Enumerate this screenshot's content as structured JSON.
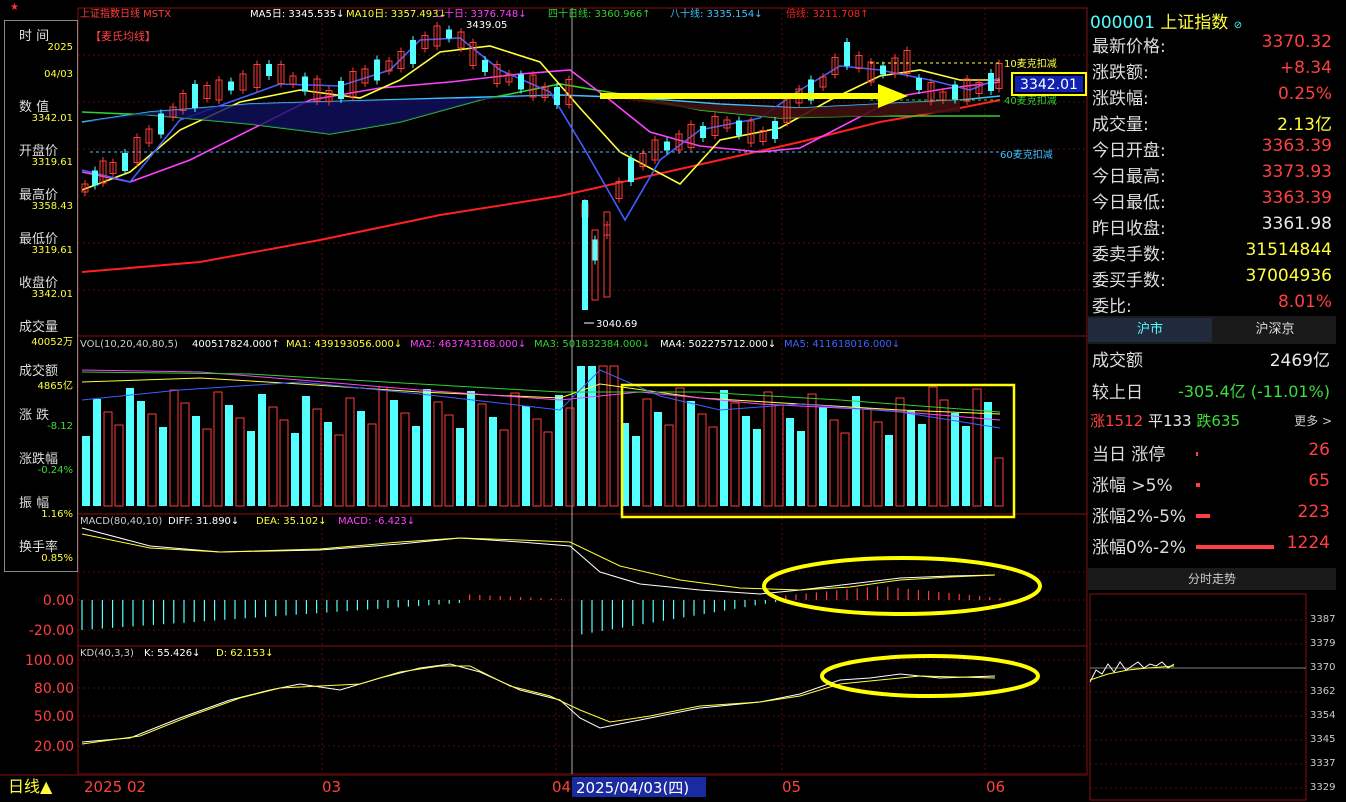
{
  "colors": {
    "up": "#ff3c3c",
    "down": "#54ffff",
    "ma5": "#ffffff",
    "ma10": "#ffff3a",
    "ma20": "#ff40ff",
    "ma40": "#30d030",
    "ma60": "#40c0ff",
    "ma_long": "#ff2020",
    "highlight": "#ffff00"
  },
  "header": {
    "legend_prefix": "上证指数日线 MSTX",
    "ma5": "MA5日: 3345.535↓",
    "ma10": "MA10日: 3357.493↓",
    "ma20": "二十日: 3376.748↓",
    "ma40": "四十日线: 3360.966↑",
    "ma80": "八十线: 3335.154↓",
    "ma_ratio": "倍线: 3211.708↑",
    "subtitle": "【麦氏均线】",
    "high_label": "3439.05",
    "low_label": "3040.69",
    "deduct10": "10麦克扣减",
    "deduct40": "40麦克扣减",
    "deduct60": "60麦克扣减",
    "price_tag": "3342.01"
  },
  "data_window": {
    "items": [
      {
        "label": "时 间",
        "value": ""
      },
      {
        "label": "",
        "value": "2025"
      },
      {
        "label": "",
        "value": "04/03"
      },
      {
        "label": "数 值",
        "value": ""
      },
      {
        "label": "",
        "value": "3342.01"
      },
      {
        "label": "开盘价",
        "value": ""
      },
      {
        "label": "",
        "value": "3319.61"
      },
      {
        "label": "最高价",
        "value": ""
      },
      {
        "label": "",
        "value": "3358.43"
      },
      {
        "label": "最低价",
        "value": ""
      },
      {
        "label": "",
        "value": "3319.61"
      },
      {
        "label": "收盘价",
        "value": ""
      },
      {
        "label": "",
        "value": "3342.01"
      },
      {
        "label": "成交量",
        "value": ""
      },
      {
        "label": "",
        "value": "40052万"
      },
      {
        "label": "成交额",
        "value": ""
      },
      {
        "label": "",
        "value": "4865亿"
      },
      {
        "label": "涨 跌",
        "value": ""
      },
      {
        "label": "",
        "value": "-8.12"
      },
      {
        "label": "涨跌幅",
        "value": ""
      },
      {
        "label": "",
        "value": "-0.24%"
      },
      {
        "label": "振 幅",
        "value": ""
      },
      {
        "label": "",
        "value": "1.16%"
      },
      {
        "label": "换手率",
        "value": ""
      },
      {
        "label": "",
        "value": "0.85%"
      }
    ]
  },
  "volume": {
    "title": "VOL(10,20,40,80,5)",
    "v": "400517824.000↑",
    "ma1": "MA1: 439193056.000↓",
    "ma2": "MA2: 463743168.000↓",
    "ma3": "MA3: 501832384.000↓",
    "ma4": "MA4: 502275712.000↓",
    "ma5": "MA5: 411618016.000↓"
  },
  "macd": {
    "title": "MACD(80,40,10)",
    "diff": "DIFF: 31.890↓",
    "dea": "DEA: 35.102↓",
    "macd": "MACD: -6.423↓",
    "ticks": [
      "0.00",
      "-20.00"
    ]
  },
  "kd": {
    "title": "KD(40,3,3)",
    "k": "K: 55.426↓",
    "d": "D: 62.153↓",
    "ticks": [
      "100.00",
      "80.00",
      "50.00",
      "20.00"
    ]
  },
  "xaxis": {
    "period": "日线▲",
    "labels": [
      "2025 02",
      "03",
      "04",
      "05",
      "06"
    ],
    "cursor_date": "2025/04/03(四)"
  },
  "panel": {
    "code": "000001",
    "name": "上证指数",
    "rows": [
      {
        "label": "最新价格:",
        "value": "3370.32",
        "color": "red"
      },
      {
        "label": "涨跌额:",
        "value": "+8.34",
        "color": "red"
      },
      {
        "label": "涨跌幅:",
        "value": "0.25%",
        "color": "red"
      },
      {
        "label": "成交量:",
        "value": "2.13亿",
        "color": "yellow"
      },
      {
        "label": "今日开盘:",
        "value": "3363.39",
        "color": "red"
      },
      {
        "label": "今日最高:",
        "value": "3373.93",
        "color": "red"
      },
      {
        "label": "今日最低:",
        "value": "3363.39",
        "color": "red"
      },
      {
        "label": "昨日收盘:",
        "value": "3361.98",
        "color": "white"
      },
      {
        "label": "委卖手数:",
        "value": "31514844",
        "color": "yellow"
      },
      {
        "label": "委买手数:",
        "value": "37004936",
        "color": "yellow"
      },
      {
        "label": "委比:",
        "value": "8.01%",
        "color": "red"
      }
    ],
    "tabs": [
      "沪市",
      "沪深京"
    ],
    "turnover_label": "成交额",
    "turnover_value": "2469亿",
    "compare_label": "较上日",
    "compare_value": "-305.4亿 (-11.01%)",
    "breadth": {
      "up": "涨1512",
      "flat": "平133",
      "down": "跌635",
      "more": "更多 >"
    },
    "limits": [
      {
        "label": "当日 涨停",
        "value": "26",
        "bar": 0.02
      },
      {
        "label": "涨幅 >5%",
        "value": "65",
        "bar": 0.05
      },
      {
        "label": "涨幅2%-5%",
        "value": "223",
        "bar": 0.18
      },
      {
        "label": "涨幅0%-2%",
        "value": "1224",
        "bar": 1.0
      }
    ],
    "intraday_title": "分时走势",
    "intraday_ticks": [
      "3387",
      "3379",
      "3370",
      "3362",
      "3354",
      "3345",
      "3337",
      "3329"
    ]
  },
  "chart_data": {
    "type": "candlestick",
    "ylim": [
      3020,
      3460
    ],
    "price_labels": {
      "high": 3439.05,
      "low": 3040.69
    }
  }
}
